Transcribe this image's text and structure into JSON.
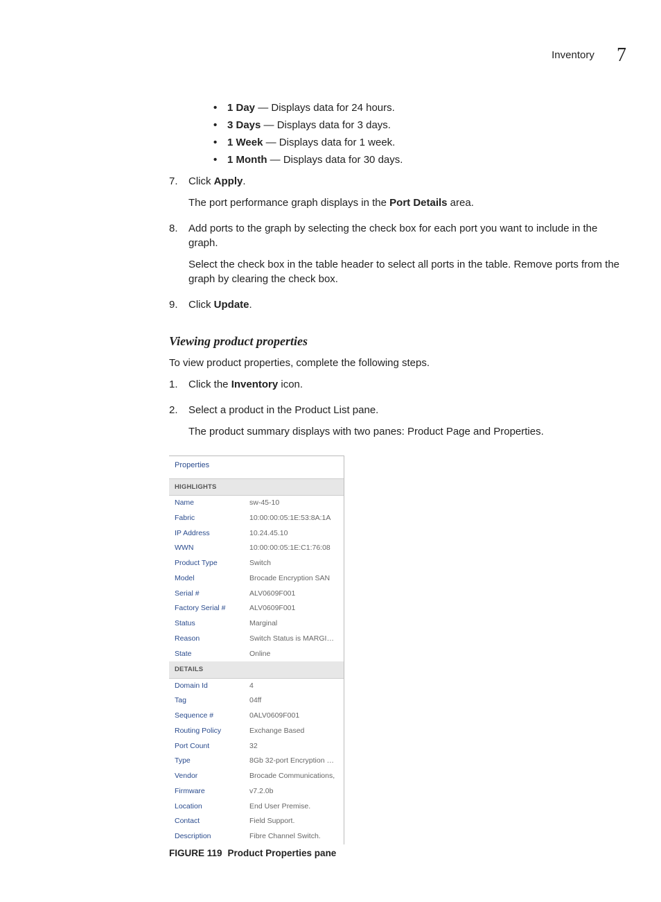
{
  "header": {
    "title": "Inventory",
    "chapter": "7"
  },
  "bullets": [
    {
      "term": "1 Day",
      "desc": " — Displays data for 24 hours."
    },
    {
      "term": "3 Days",
      "desc": " — Displays data for 3 days."
    },
    {
      "term": "1 Week",
      "desc": " — Displays data for 1 week."
    },
    {
      "term": "1 Month",
      "desc": " — Displays data for 30 days."
    }
  ],
  "step7": {
    "num": "7.",
    "line1a": "Click ",
    "line1b": "Apply",
    "line1c": ".",
    "line2a": "The port performance graph displays in the ",
    "line2b": "Port Details",
    "line2c": " area."
  },
  "step8": {
    "num": "8.",
    "line1": "Add ports to the graph by selecting the check box for each port you want to include in the graph.",
    "line2": "Select the check box in the table header to select all ports in the table. Remove ports from the graph by clearing the check box."
  },
  "step9": {
    "num": "9.",
    "linea": "Click ",
    "lineb": "Update",
    "linec": "."
  },
  "section": {
    "heading": "Viewing product properties",
    "intro": "To view product properties, complete the following steps.",
    "s1": {
      "num": "1.",
      "a": "Click the ",
      "b": "Inventory",
      "c": " icon."
    },
    "s2": {
      "num": "2.",
      "line1": "Select a product in the Product List pane.",
      "line2": "The product summary displays with two panes: Product Page and Properties."
    }
  },
  "properties": {
    "title": "Properties",
    "sec1": "HIGHLIGHTS",
    "sec2": "DETAILS",
    "highlights": [
      {
        "k": "Name",
        "v": "sw-45-10"
      },
      {
        "k": "Fabric",
        "v": "10:00:00:05:1E:53:8A:1A"
      },
      {
        "k": "IP Address",
        "v": "10.24.45.10"
      },
      {
        "k": "WWN",
        "v": "10:00:00:05:1E:C1:76:08"
      },
      {
        "k": "Product Type",
        "v": "Switch"
      },
      {
        "k": "Model",
        "v": "Brocade Encryption SAN"
      },
      {
        "k": "Serial #",
        "v": "ALV0609F001"
      },
      {
        "k": "Factory Serial #",
        "v": "ALV0609F001"
      },
      {
        "k": "Status",
        "v": "Marginal"
      },
      {
        "k": "Reason",
        "v": "Switch Status is MARGINAL ..."
      },
      {
        "k": "State",
        "v": "Online"
      }
    ],
    "details": [
      {
        "k": "Domain Id",
        "v": "4"
      },
      {
        "k": "Tag",
        "v": "04ff"
      },
      {
        "k": "Sequence #",
        "v": "0ALV0609F001"
      },
      {
        "k": "Routing Policy",
        "v": "Exchange Based"
      },
      {
        "k": "Port Count",
        "v": "32"
      },
      {
        "k": "Type",
        "v": "8Gb 32-port Encryption Sw..."
      },
      {
        "k": "Vendor",
        "v": "Brocade Communications,"
      },
      {
        "k": "Firmware",
        "v": "v7.2.0b"
      },
      {
        "k": "Location",
        "v": "End User Premise."
      },
      {
        "k": "Contact",
        "v": "Field Support."
      },
      {
        "k": "Description",
        "v": "Fibre Channel Switch."
      }
    ]
  },
  "figure": {
    "label": "FIGURE 119",
    "caption": "Product Properties pane"
  }
}
